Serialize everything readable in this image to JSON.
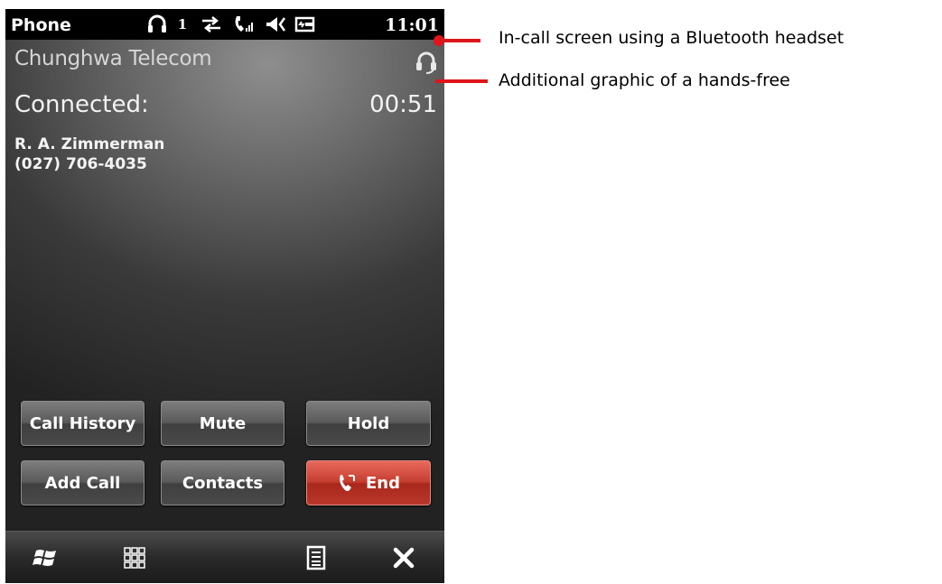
{
  "status_bar": {
    "app_title": "Phone",
    "signal_count": "1",
    "time": "11:01",
    "icons": [
      "headset-icon",
      "data-sync-icon",
      "call-signal-icon",
      "speaker-icon",
      "battery-icon"
    ]
  },
  "call": {
    "carrier": "Chunghwa Telecom",
    "status": "Connected:",
    "duration": "00:51",
    "contact_name": "R. A. Zimmerman",
    "contact_number": "(027) 706-4035"
  },
  "buttons": {
    "call_history": "Call History",
    "mute": "Mute",
    "hold": "Hold",
    "add_call": "Add Call",
    "contacts": "Contacts",
    "end": "End"
  },
  "taskbar": {
    "icons": [
      "windows-start-icon",
      "keypad-icon",
      "menu-icon",
      "close-icon"
    ]
  },
  "annotations": {
    "headset": "In-call screen using a Bluetooth headset",
    "handsfree": "Additional graphic of a hands-free"
  },
  "colors": {
    "annotation": "#e0151b",
    "end_button": "#c53d2f"
  }
}
